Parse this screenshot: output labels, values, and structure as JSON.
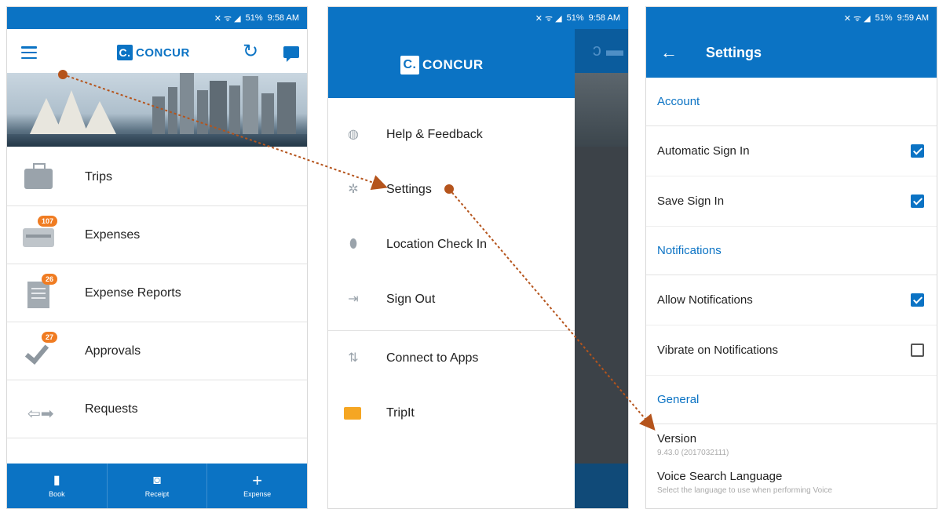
{
  "colors": {
    "brand": "#0b73c4",
    "badge": "#f07c22",
    "arrow": "#b5541c"
  },
  "screen1": {
    "status": {
      "signal": "51%",
      "time": "9:58 AM"
    },
    "logo": {
      "mark": "C.",
      "text": "CONCUR"
    },
    "menu": [
      {
        "label": "Trips",
        "icon": "suitcase-icon",
        "badge": ""
      },
      {
        "label": "Expenses",
        "icon": "credit-card-icon",
        "badge": "107"
      },
      {
        "label": "Expense Reports",
        "icon": "document-icon",
        "badge": "26"
      },
      {
        "label": "Approvals",
        "icon": "checkmark-icon",
        "badge": "27"
      },
      {
        "label": "Requests",
        "icon": "arrows-icon",
        "badge": ""
      }
    ],
    "bottom": [
      {
        "label": "Book",
        "icon": "suitcase-icon"
      },
      {
        "label": "Receipt",
        "icon": "camera-icon"
      },
      {
        "label": "Expense",
        "icon": "plus-icon"
      }
    ]
  },
  "screen2": {
    "status": {
      "signal": "51%",
      "time": "9:58 AM"
    },
    "logo": {
      "mark": "C.",
      "text": "CONCUR"
    },
    "drawer": [
      {
        "label": "Help & Feedback",
        "icon": "globe-icon"
      },
      {
        "label": "Settings",
        "icon": "gear-icon"
      },
      {
        "label": "Location Check In",
        "icon": "location-pin-icon"
      },
      {
        "label": "Sign Out",
        "icon": "sign-out-icon"
      },
      {
        "label": "Connect to Apps",
        "icon": "sync-icon"
      },
      {
        "label": "TripIt",
        "icon": "tripit-icon"
      }
    ]
  },
  "screen3": {
    "status": {
      "signal": "51%",
      "time": "9:59 AM"
    },
    "title": "Settings",
    "sections": {
      "account": "Account",
      "notifications": "Notifications",
      "general": "General"
    },
    "settings": {
      "auto_sign_in": "Automatic Sign In",
      "save_sign_in": "Save Sign In",
      "allow_notifications": "Allow Notifications",
      "vibrate_notifications": "Vibrate on Notifications"
    },
    "version": {
      "label": "Version",
      "value": "9.43.0 (2017032111)"
    },
    "voice": {
      "label": "Voice Search Language",
      "hint": "Select the language to use when performing Voice"
    }
  }
}
